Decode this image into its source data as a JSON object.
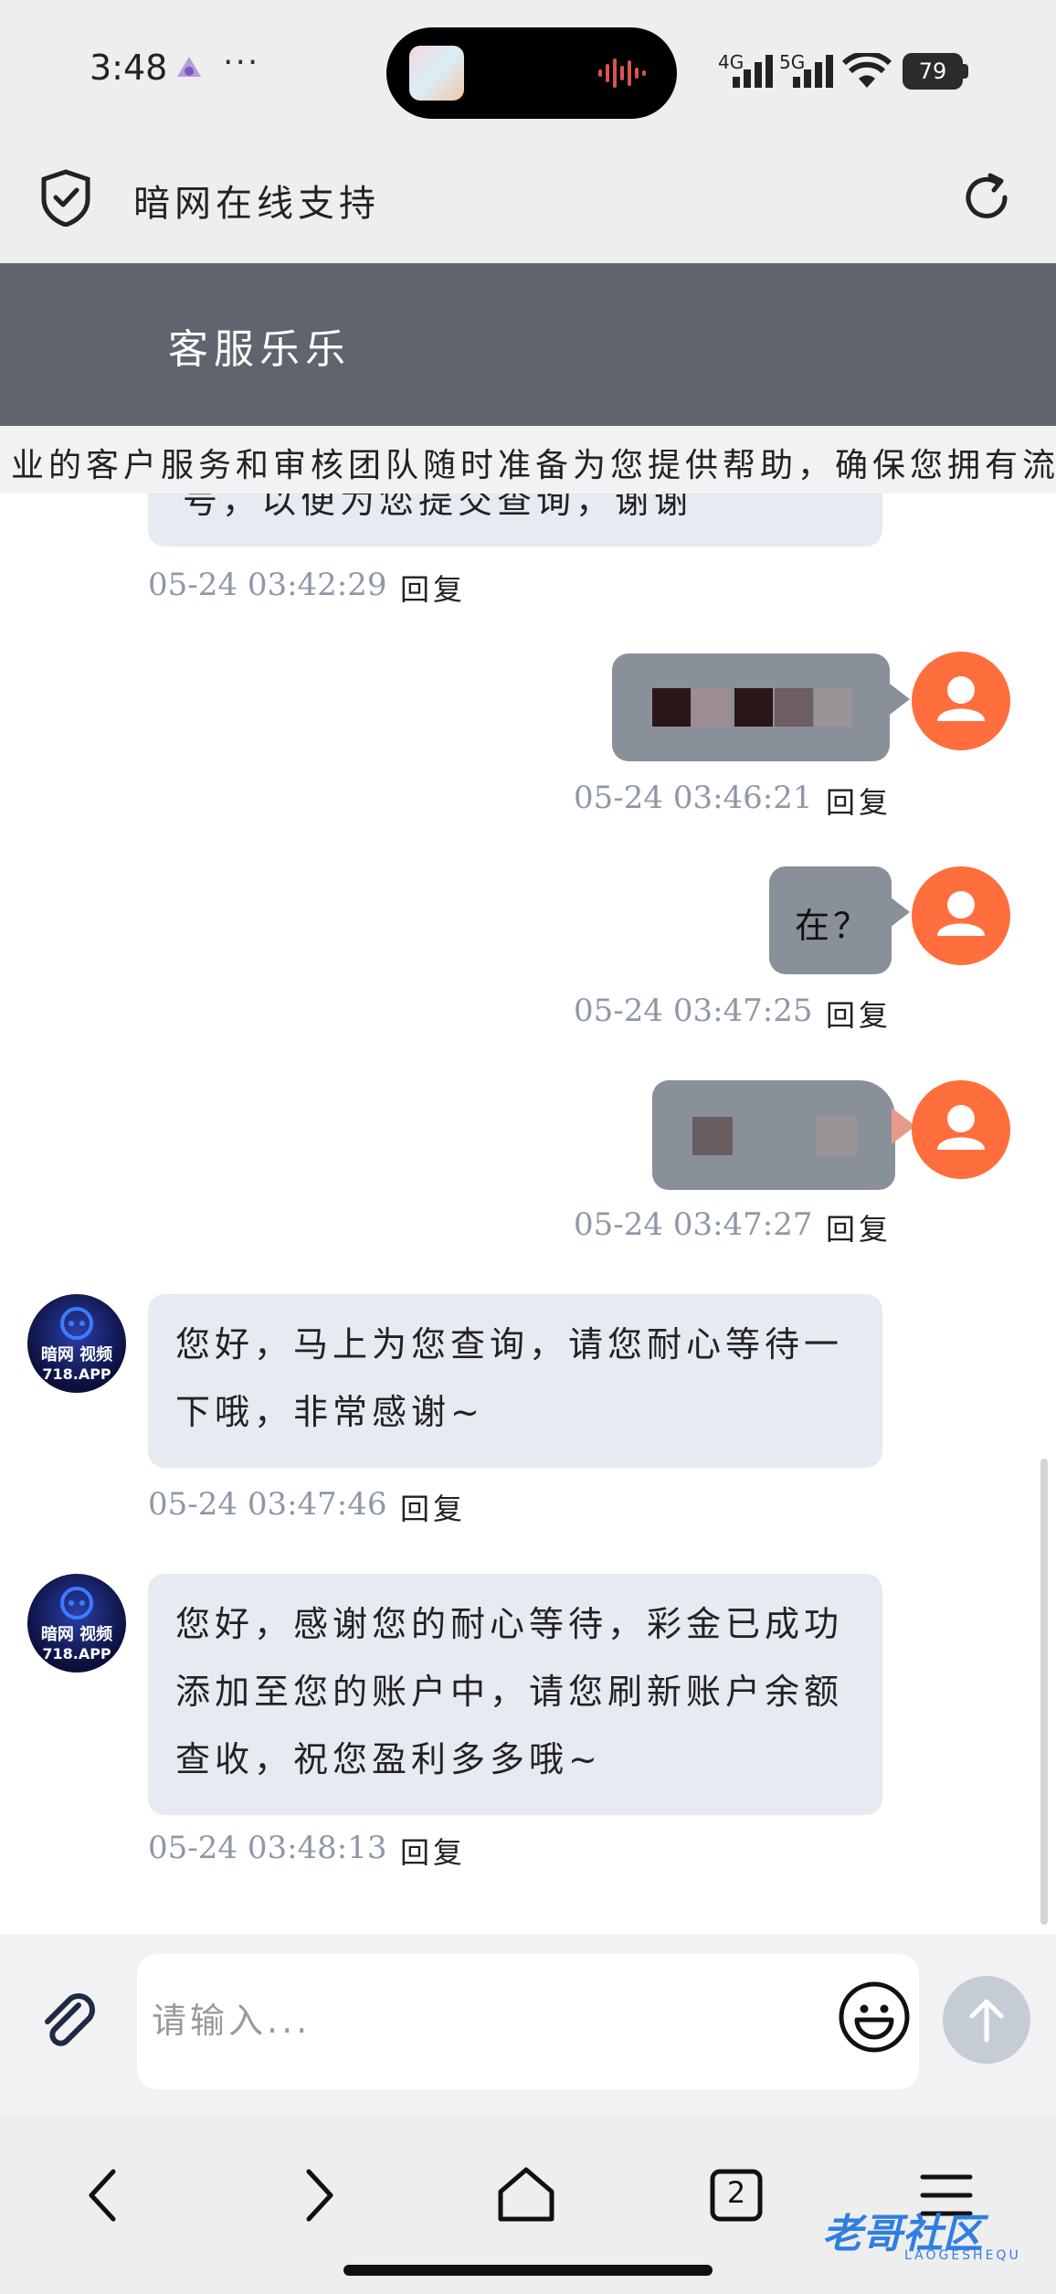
{
  "status_bar": {
    "time": "3:48",
    "more": "···",
    "net1": "4G",
    "net2": "5G",
    "battery": "79"
  },
  "browser": {
    "site_title": "暗网在线支持"
  },
  "chat": {
    "agent_name": "客服乐乐",
    "marquee": "业的客户服务和审核团队随时准备为您提供帮助，确保您拥有流畅",
    "messages": [
      {
        "side": "in",
        "text_partial": "号，以便为您提交查询，谢谢",
        "time": "05-24 03:42:29",
        "reply": "回复"
      },
      {
        "side": "out",
        "text": "",
        "time": "05-24 03:46:21",
        "reply": "回复"
      },
      {
        "side": "out",
        "text": "在？",
        "time": "05-24 03:47:25",
        "reply": "回复"
      },
      {
        "side": "out",
        "text": "",
        "time": "05-24 03:47:27",
        "reply": "回复"
      },
      {
        "side": "in",
        "line1": "您好，马上为您查询，请您耐心等待一",
        "line2": "下哦，非常感谢~",
        "time": "05-24 03:47:46",
        "reply": "回复",
        "avatar_line1": "暗网 视频",
        "avatar_line2": "718.APP"
      },
      {
        "side": "in",
        "line1": "您好，感谢您的耐心等待，彩金已成功",
        "line2": "添加至您的账户中，请您刷新账户余额",
        "line3": "查收，祝您盈利多多哦~",
        "time": "05-24 03:48:13",
        "reply": "回复",
        "avatar_line1": "暗网 视频",
        "avatar_line2": "718.APP"
      }
    ]
  },
  "input": {
    "placeholder": "请输入..."
  },
  "bottom_nav": {
    "tabs_count": "2"
  },
  "watermark": {
    "text": "老哥社区",
    "sub": "LAOGESHEQU"
  },
  "colors": {
    "header_bg": "#5f646d",
    "user_avatar": "#ff6e3c",
    "bubble_in": "#e6eaf1",
    "bubble_out": "#8a9099"
  }
}
